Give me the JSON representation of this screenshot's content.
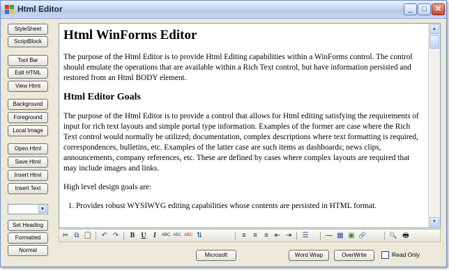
{
  "window": {
    "title": "Html Editor"
  },
  "title_controls": {
    "minimize": "_",
    "maximize": "□",
    "close": "✕"
  },
  "sidebar": {
    "group1": [
      "StyleSheet",
      "ScriptBlock"
    ],
    "group2": [
      "Tool Bar",
      "Edit HTML",
      "View Html"
    ],
    "group3": [
      "Background",
      "Foreground",
      "Local Image"
    ],
    "group4": [
      "Open Html",
      "Save Html",
      "Insert Html",
      "Insert Text"
    ],
    "combo_value": "",
    "group5": [
      "Set Heading",
      "Formatted",
      "Normal"
    ]
  },
  "document": {
    "heading1": "Html WinForms Editor",
    "para1": "The purpose of the Html Editor is to provide Html Editing capabilities within a WinForms control. The control should emulate the operations that are available within a Rich Text control, but have information persisted and restored from an Html BODY element.",
    "heading2": "Html Editor Goals",
    "para2": "The purpose of the Html Editor is to provide a control that allows for Html editing satisfying the requirements of input for rich text layouts and simple portal type information. Examples of the former are case where the Rich Text control would normally be utilized; documentation, complex descriptions where text formatting is required, correspondences, bulletins, etc. Examples of the latter case are such items as dashboards; news clips, announcements, company references, etc. These are defined by cases where complex layouts are required that may include images and links.",
    "para3": "High level design goals are:",
    "list_item1": "Provides robust WYSIWYG editing capabilities whose contents are persisted in HTML format."
  },
  "toolbar": {
    "cut": "✂",
    "copy": "⧉",
    "paste": "📋",
    "undo": "↶",
    "redo": "↷",
    "bold": "B",
    "underline": "U",
    "italic": "I",
    "abc1": "ABC",
    "abc2": "ABC",
    "abc3": "ABC",
    "sort": "⇅",
    "align_left": "≡",
    "align_center": "≡",
    "align_right": "≡",
    "outdent": "⇤",
    "indent": "⇥",
    "list": "☰",
    "hr": "—",
    "table": "▦",
    "image": "▣",
    "link": "🔗",
    "find": "🔍",
    "print": "🖶"
  },
  "bottom": {
    "microsoft": "Microsoft",
    "word_wrap": "Word Wrap",
    "overwrite": "OverWrite",
    "read_only": "Read Only",
    "read_only_checked": false
  }
}
